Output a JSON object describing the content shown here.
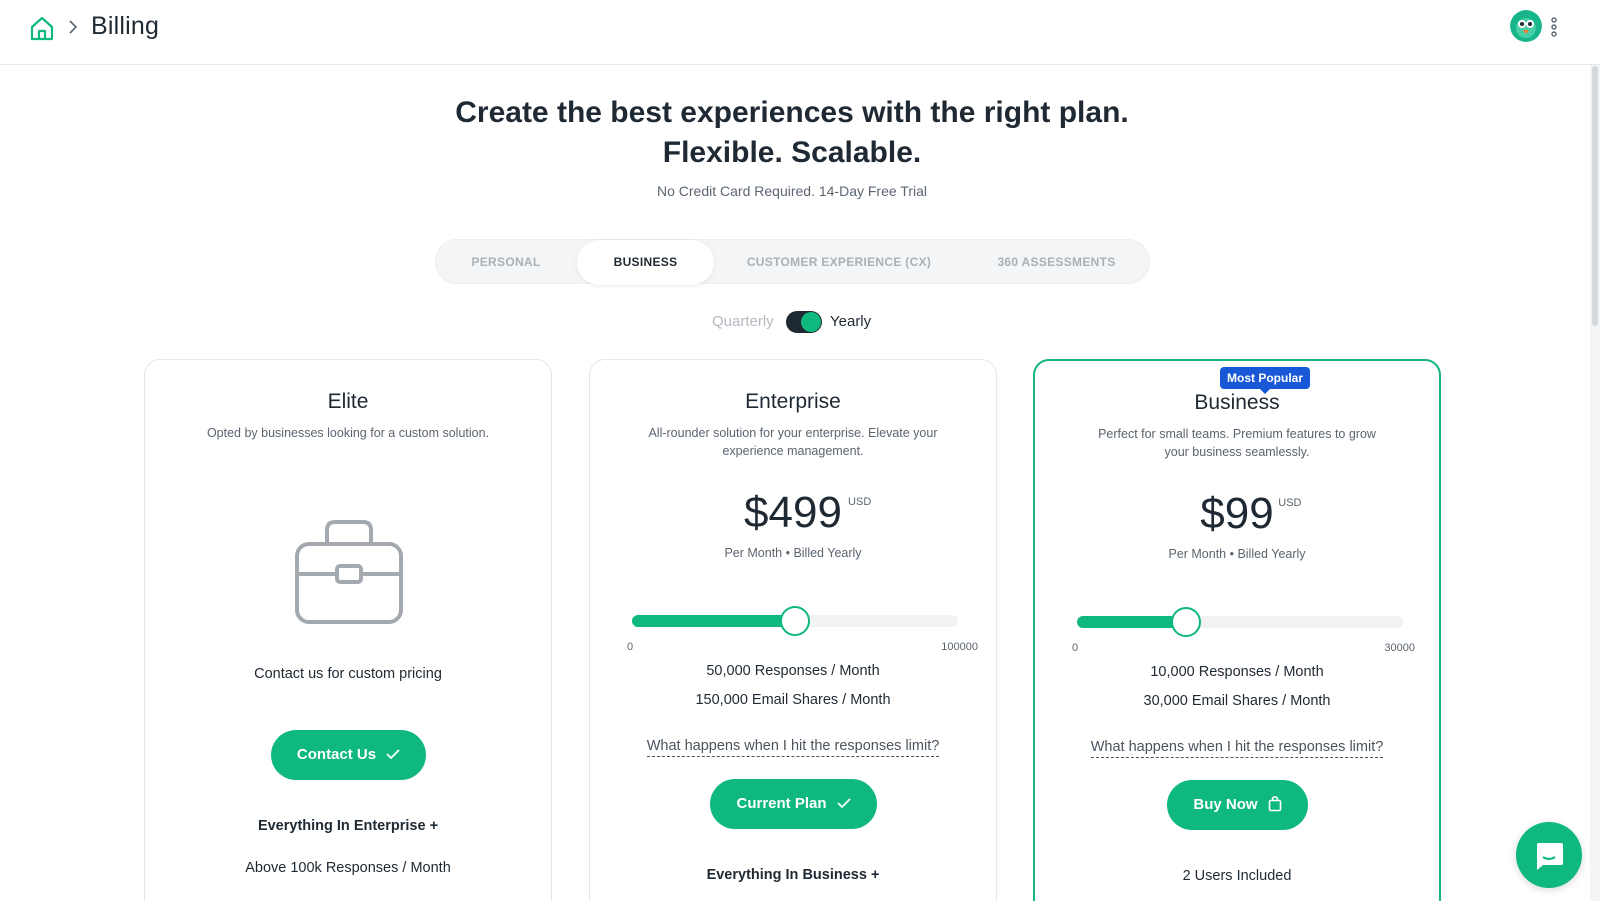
{
  "header": {
    "page_title": "Billing",
    "home_icon": "home-icon",
    "separator_icon": "chevron-right-icon",
    "more_icon": "more-vertical-icon"
  },
  "hero": {
    "title_line1": "Create the best experiences with the right plan.",
    "title_line2": "Flexible. Scalable.",
    "subtitle": "No Credit Card Required. 14-Day Free Trial"
  },
  "tabs": [
    {
      "label": "PERSONAL",
      "active": false
    },
    {
      "label": "BUSINESS",
      "active": true
    },
    {
      "label": "CUSTOMER EXPERIENCE (CX)",
      "active": false
    },
    {
      "label": "360 ASSESSMENTS",
      "active": false
    }
  ],
  "billing_toggle": {
    "left_label": "Quarterly",
    "right_label": "Yearly",
    "selected": "Yearly"
  },
  "plans": {
    "elite": {
      "name": "Elite",
      "description": "Opted by businesses looking for a custom solution.",
      "icon": "briefcase-icon",
      "pricing_text": "Contact us for custom pricing",
      "button_label": "Contact Us",
      "everything_label": "Everything In Enterprise +",
      "feature_1": "Above 100k Responses / Month"
    },
    "enterprise": {
      "name": "Enterprise",
      "description": "All-rounder solution for your enterprise. Elevate your experience management.",
      "price": "$499",
      "currency": "USD",
      "per": "Per Month • Billed Yearly",
      "slider_min": "0",
      "slider_max": "100000",
      "slider_fraction": 0.5,
      "responses": "50,000 Responses / Month",
      "email_shares": "150,000 Email Shares / Month",
      "limit_link": "What happens when I hit the responses limit?",
      "button_label": "Current Plan",
      "everything_label": "Everything In Business +"
    },
    "business": {
      "name": "Business",
      "badge": "Most Popular",
      "description": "Perfect for small teams. Premium features to grow your business seamlessly.",
      "price": "$99",
      "currency": "USD",
      "per": "Per Month • Billed Yearly",
      "slider_min": "0",
      "slider_max": "30000",
      "slider_fraction": 0.333,
      "responses": "10,000 Responses / Month",
      "email_shares": "30,000 Email Shares / Month",
      "limit_link": "What happens when I hit the responses limit?",
      "button_label": "Buy Now",
      "feature_1": "2 Users Included"
    }
  },
  "colors": {
    "accent": "#0fb97d",
    "badge": "#1858d6",
    "text": "#1f2933"
  },
  "chat_icon": "chat-bubble-icon"
}
